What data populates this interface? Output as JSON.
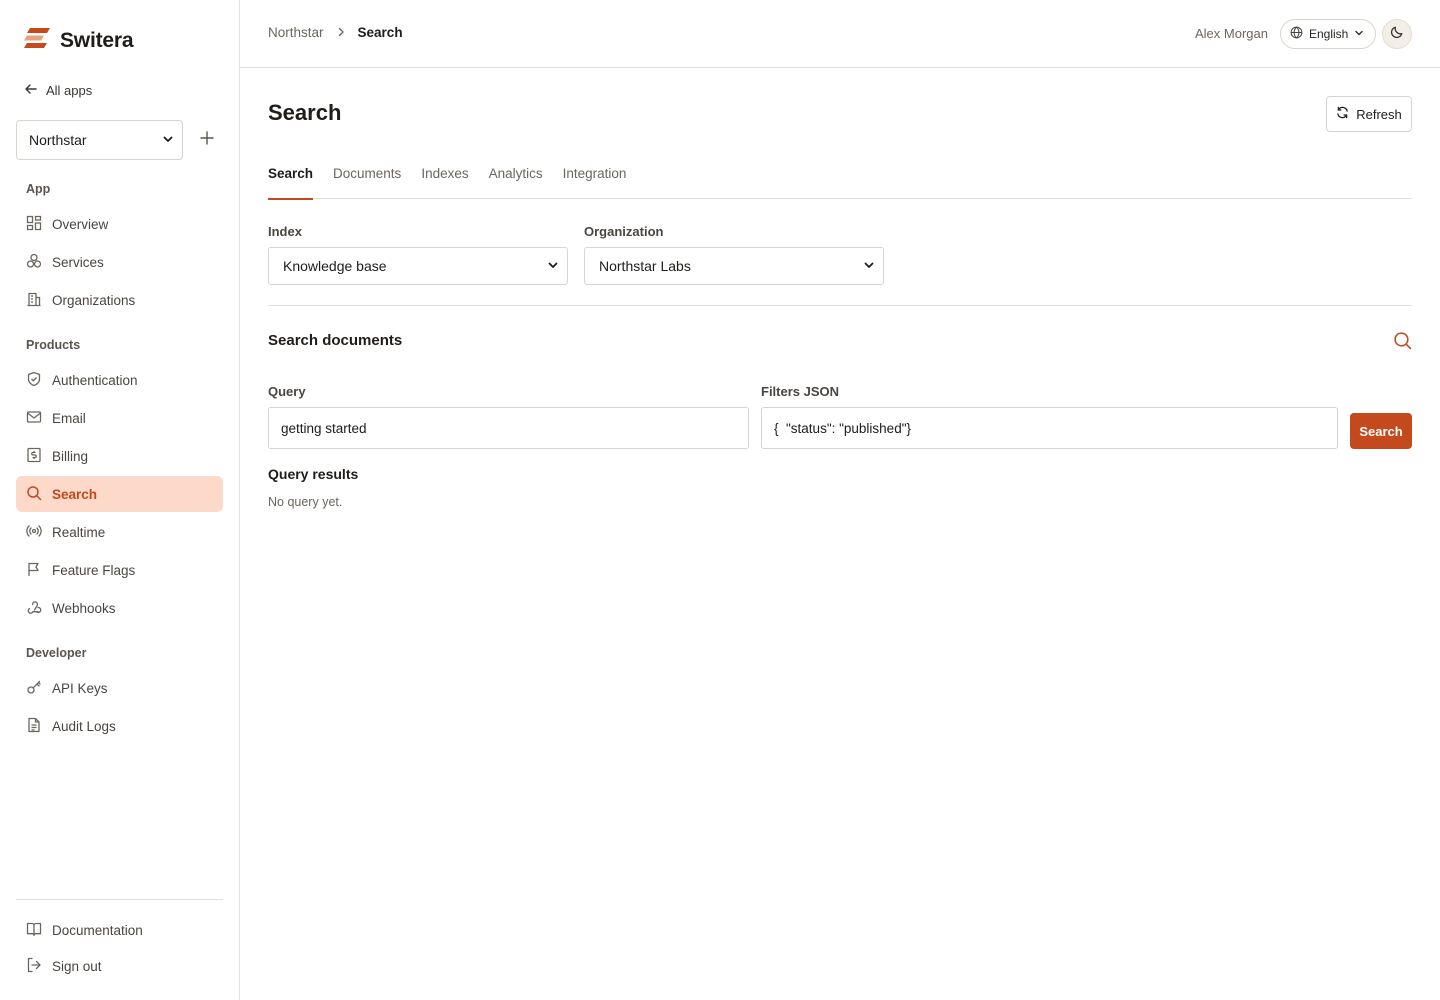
{
  "brand": {
    "name": "Switera",
    "accent": "#c4491c",
    "accent_light": "#fdd9ca"
  },
  "sidebar": {
    "all_apps": "All apps",
    "app_select": {
      "value": "Northstar"
    },
    "sections": {
      "app": "App",
      "products": "Products",
      "developer": "Developer"
    },
    "app_items": [
      {
        "label": "Overview",
        "icon": "grid-icon"
      },
      {
        "label": "Services",
        "icon": "services-icon"
      },
      {
        "label": "Organizations",
        "icon": "building-icon"
      }
    ],
    "product_items": [
      {
        "label": "Authentication",
        "icon": "shield-icon"
      },
      {
        "label": "Email",
        "icon": "mail-icon"
      },
      {
        "label": "Billing",
        "icon": "billing-icon"
      },
      {
        "label": "Search",
        "icon": "search-icon",
        "active": true
      },
      {
        "label": "Realtime",
        "icon": "broadcast-icon"
      },
      {
        "label": "Feature Flags",
        "icon": "flag-icon"
      },
      {
        "label": "Webhooks",
        "icon": "webhook-icon"
      }
    ],
    "developer_items": [
      {
        "label": "API Keys",
        "icon": "key-icon"
      },
      {
        "label": "Audit Logs",
        "icon": "file-icon"
      }
    ],
    "footer_items": [
      {
        "label": "Documentation",
        "icon": "book-icon"
      },
      {
        "label": "Sign out",
        "icon": "sign-out-icon"
      }
    ]
  },
  "header": {
    "breadcrumb": {
      "parent": "Northstar",
      "current": "Search"
    },
    "user_name": "Alex Morgan",
    "language": "English"
  },
  "main": {
    "title": "Search",
    "refresh_label": "Refresh",
    "tabs": [
      {
        "label": "Search",
        "active": true
      },
      {
        "label": "Documents"
      },
      {
        "label": "Indexes"
      },
      {
        "label": "Analytics"
      },
      {
        "label": "Integration"
      }
    ],
    "index": {
      "label": "Index",
      "value": "Knowledge base"
    },
    "organization": {
      "label": "Organization",
      "value": "Northstar Labs"
    },
    "search_card": {
      "title": "Search documents",
      "query_label": "Query",
      "query_value": "getting started",
      "filters_label": "Filters JSON",
      "filters_value": "{  \"status\": \"published\"}",
      "search_button": "Search"
    },
    "results": {
      "title": "Query results",
      "empty_text": "No query yet."
    }
  }
}
